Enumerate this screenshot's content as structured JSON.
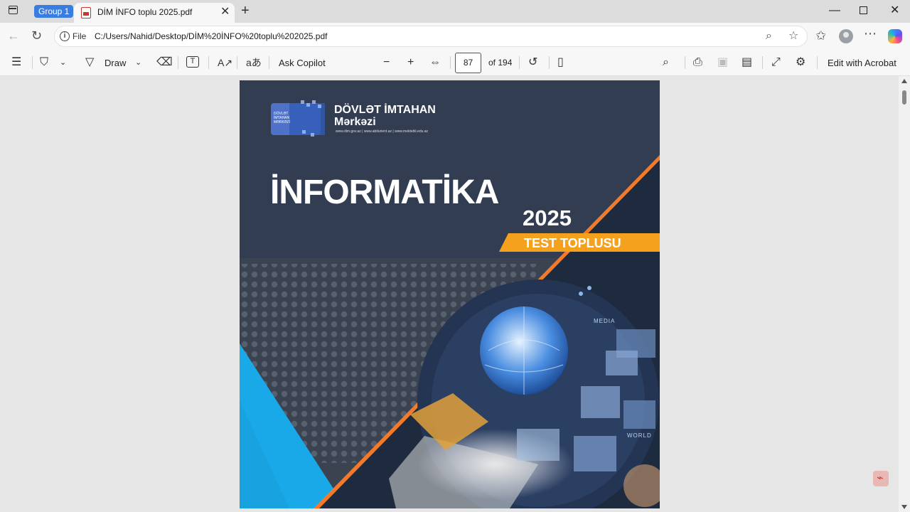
{
  "tabstrip": {
    "group_label": "Group 1",
    "tab_title": "DİM İNFO toplu 2025.pdf"
  },
  "addressbar": {
    "scheme_label": "File",
    "url": "C:/Users/Nahid/Desktop/DİM%20İNFO%20toplu%202025.pdf"
  },
  "pdf_toolbar": {
    "draw_label": "Draw",
    "ask_copilot_label": "Ask Copilot",
    "current_page": "87",
    "page_total": "of 194",
    "edit_acrobat_label": "Edit with Acrobat"
  },
  "cover": {
    "org_line1": "DÖVLƏT İMTAHAN",
    "org_line2": "Mərkəzi",
    "logo_small_text": "DÖVLƏT İMTAHAN MƏRKƏZİ",
    "org_urls": "www.dim.gov.az | www.abiturient.az | www.mektebli.edu.az",
    "title": "İNFORMATİKA",
    "year": "2025",
    "subtitle": "TEST TOPLUSU",
    "media_label": "MEDIA",
    "world_label": "WORLD"
  },
  "colors": {
    "group_chip": "#3a7de0",
    "cover_dark": "#2f3a4e",
    "cover_cyan": "#1aa9e8",
    "cover_orange": "#f4a21e"
  }
}
